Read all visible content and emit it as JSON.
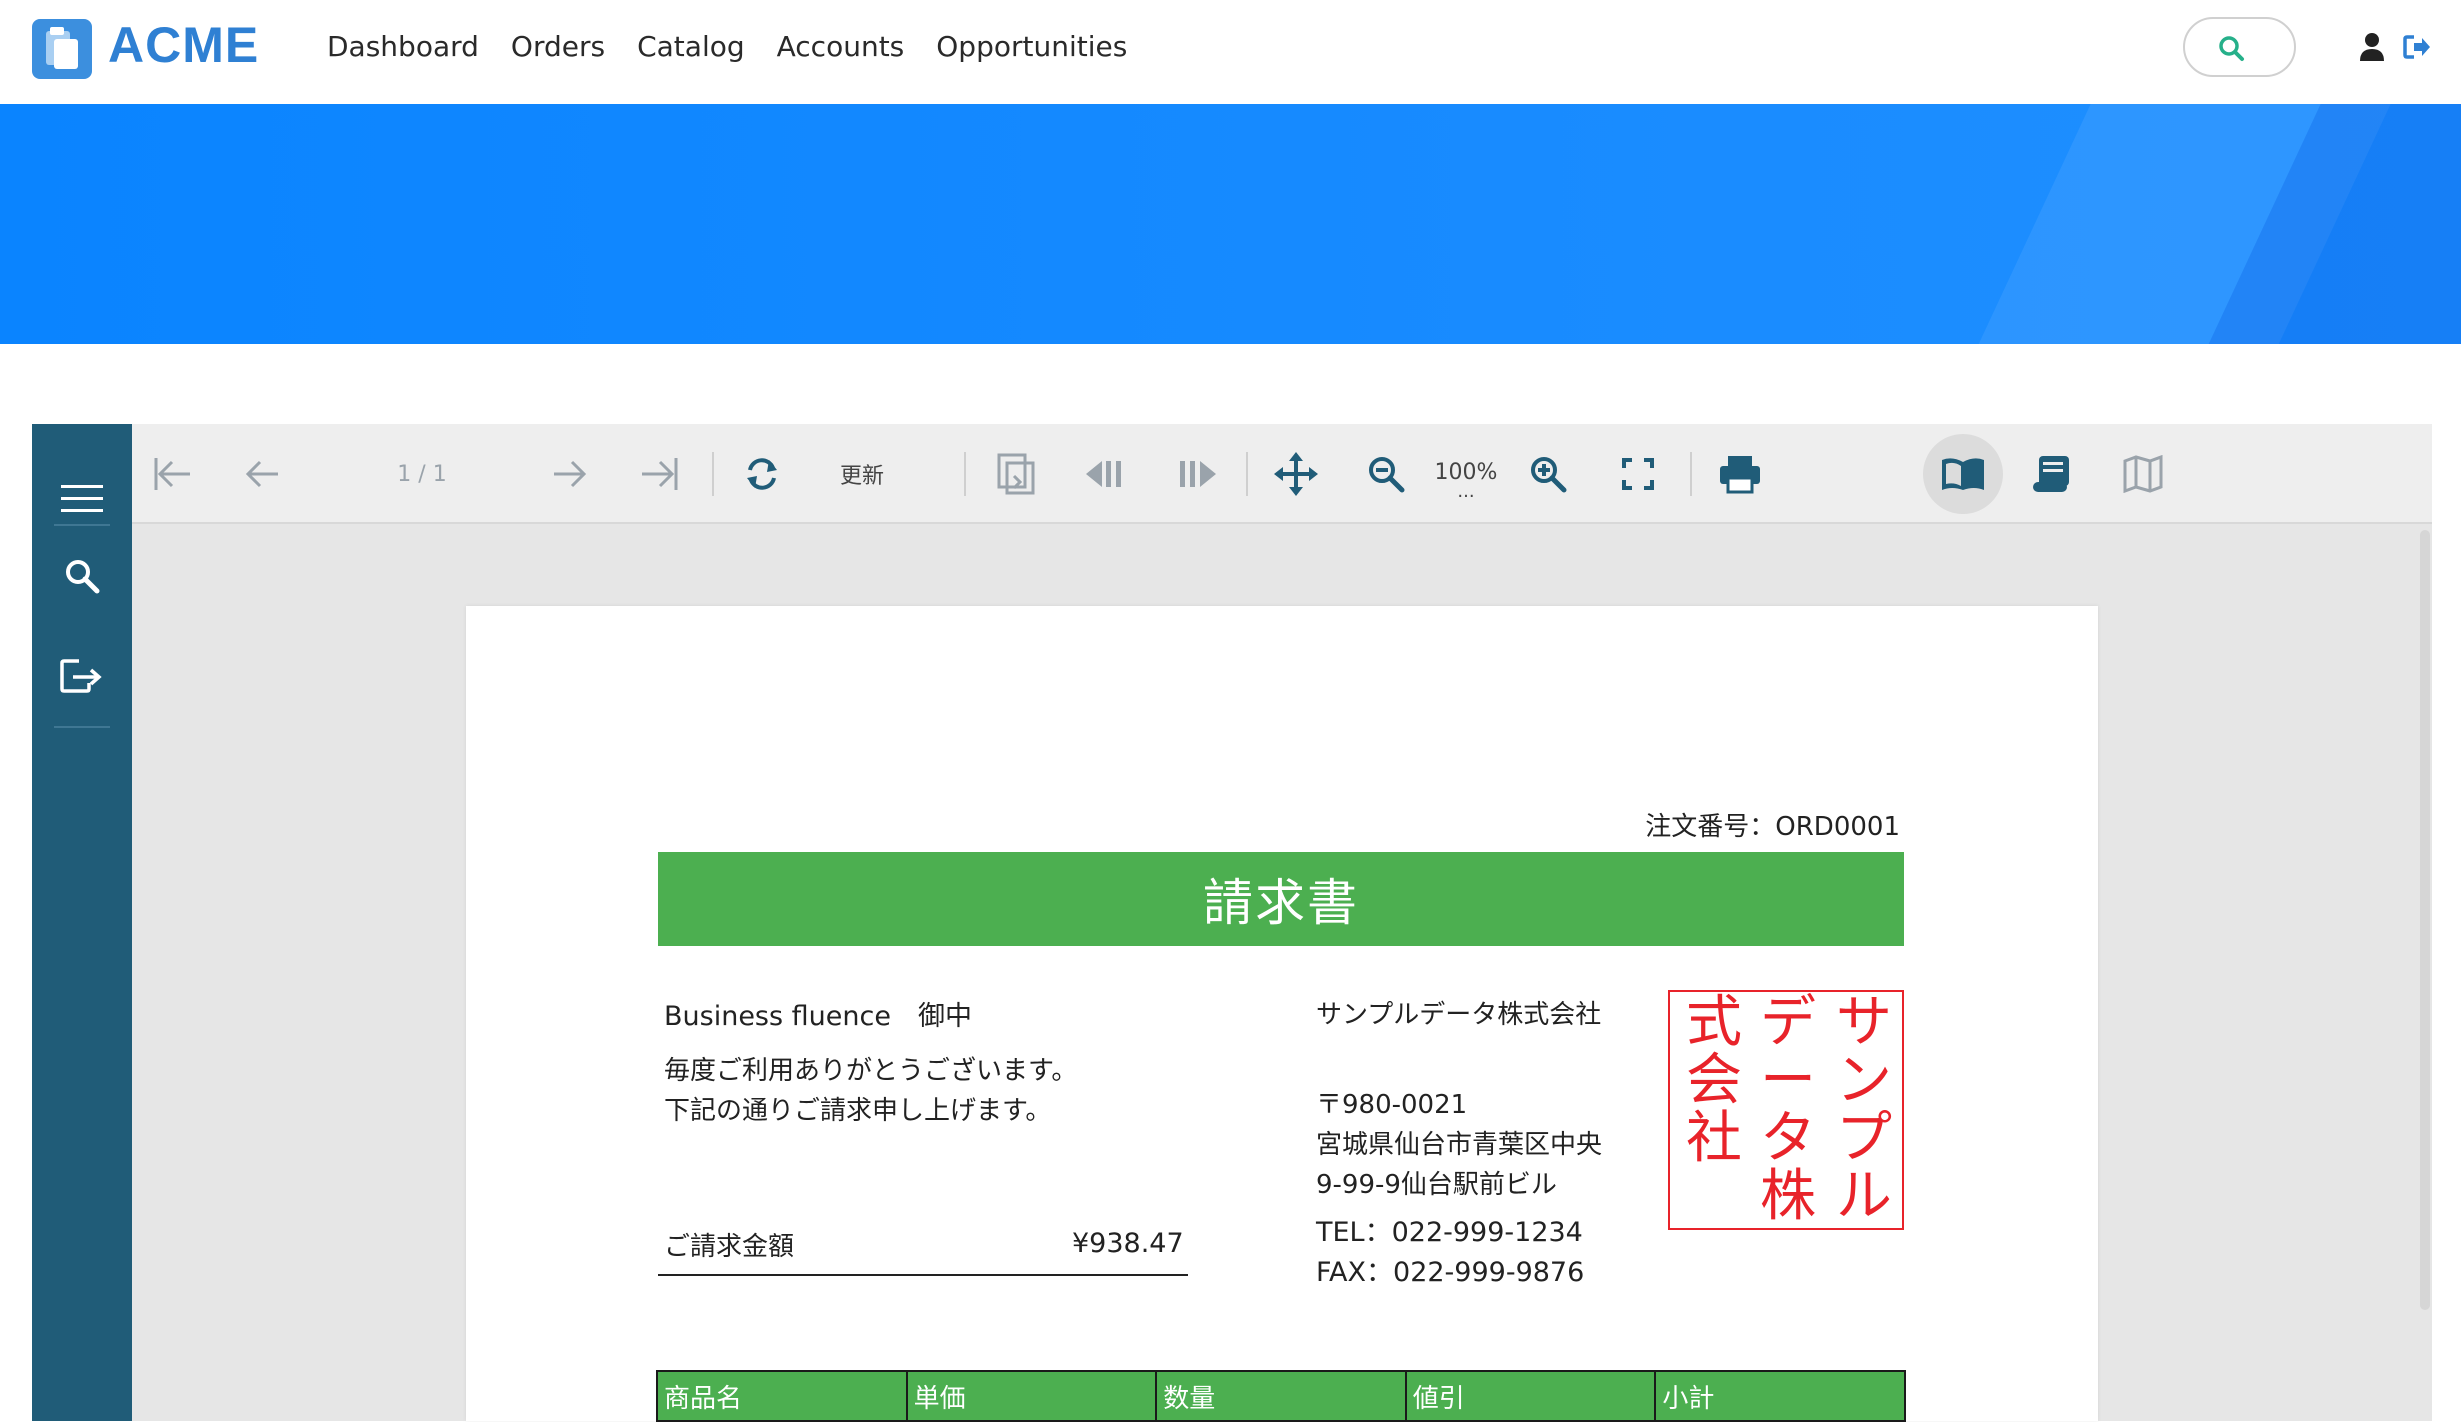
{
  "app": {
    "logo_text": "ACME",
    "nav": [
      "Dashboard",
      "Orders",
      "Catalog",
      "Accounts",
      "Opportunities"
    ]
  },
  "toolbar": {
    "page_indicator": "1 / 1",
    "refresh_label": "更新",
    "zoom_level": "100%",
    "zoom_more": "..."
  },
  "document": {
    "order_number": "注文番号：ORD0001",
    "title": "請求書",
    "customer": "Business fluence　御中",
    "greeting_line1": "毎度ご利用ありがとうございます。",
    "greeting_line2": "下記の通りご請求申し上げます。",
    "amount_label": "ご請求金額",
    "amount_value": "¥938.47",
    "company_name": "サンプルデータ株式会社",
    "postal": "〒980-0021",
    "address1": "宮城県仙台市青葉区中央",
    "address2": "9-99-9仙台駅前ビル",
    "tel": "TEL：022-999-1234",
    "fax": "FAX：022-999-9876",
    "seal_columns": [
      "サンプル",
      "データ株",
      "式会社"
    ],
    "table_headers": [
      "商品名",
      "単価",
      "数量",
      "値引",
      "小計"
    ]
  },
  "colors": {
    "accent_green": "#4caf50",
    "sidebar": "#205c78",
    "banner": "#0a84ff",
    "seal_red": "#e8232a",
    "logo_blue": "#2f80d3"
  }
}
